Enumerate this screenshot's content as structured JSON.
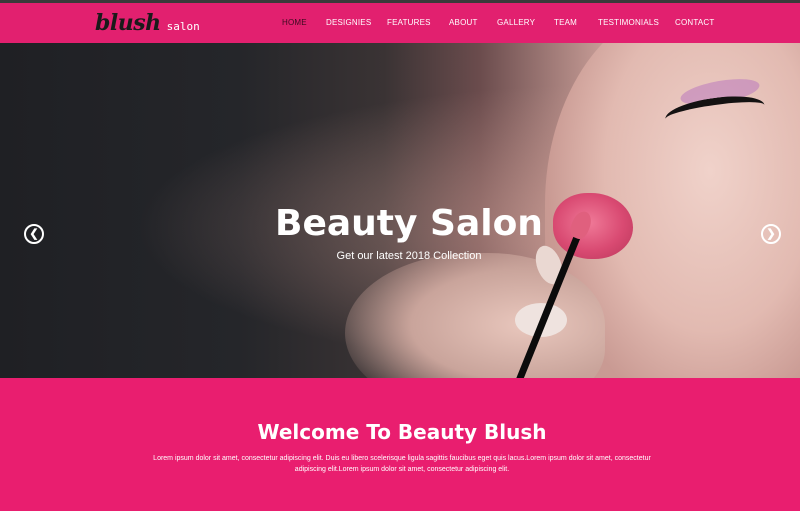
{
  "brand": {
    "script": "blush",
    "sub": "salon"
  },
  "nav": {
    "items": [
      {
        "label": "HOME",
        "active": true
      },
      {
        "label": "DESIGNIES"
      },
      {
        "label": "FEATURES"
      },
      {
        "label": "ABOUT"
      },
      {
        "label": "GALLERY"
      },
      {
        "label": "TEAM"
      },
      {
        "label": "TESTIMONIALS"
      },
      {
        "label": "CONTACT"
      }
    ]
  },
  "hero": {
    "title": "Beauty Salon",
    "subtitle": "Get our latest 2018 Collection",
    "prev_icon": "chevron-left-icon",
    "next_icon": "chevron-right-icon",
    "slide_count": 4,
    "active_slide": 1
  },
  "welcome": {
    "title": "Welcome To Beauty Blush",
    "text": "Lorem ipsum dolor sit amet, consectetur adipiscing elit. Duis eu libero scelerisque ligula sagittis faucibus eget quis lacus.Lorem ipsum dolor sit amet, consectetur adipiscing elit.Lorem ipsum dolor sit amet, consectetur adipiscing elit."
  },
  "colors": {
    "brand_pink": "#e91e6f",
    "nav_active": "#3b0a1f"
  }
}
